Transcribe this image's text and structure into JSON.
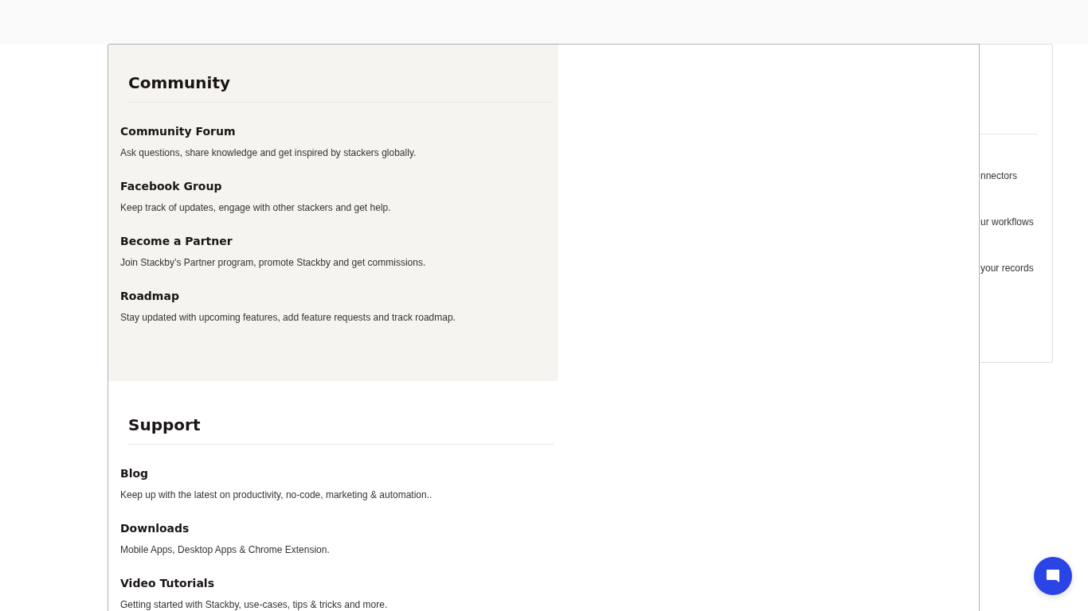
{
  "sections": [
    {
      "title": "Community",
      "kind": "tinted",
      "items": [
        {
          "title": "Community Forum",
          "description": "Ask questions, share knowledge and get inspired by stackers globally."
        },
        {
          "title": "Facebook Group",
          "description": "Keep track of updates, engage with other stackers and get help."
        },
        {
          "title": "Become a Partner",
          "description": "Join Stackby’s Partner program, promote Stackby and get commissions."
        },
        {
          "title": "Roadmap",
          "description": "Stay updated with upcoming features, add feature requests and track roadmap."
        }
      ]
    },
    {
      "title": "Support",
      "kind": "plain",
      "items": [
        {
          "title": "Blog",
          "description": "Keep up with the latest on productivity, no-code, marketing & automation.."
        },
        {
          "title": "Downloads",
          "description": "Mobile Apps, Desktop Apps & Chrome Extension."
        },
        {
          "title": "Video Tutorials",
          "description": "Getting started with Stackby, use-cases, tips & tricks and more."
        }
      ]
    }
  ],
  "back_card": {
    "lines": [
      "nnectors",
      "ur workflows",
      "your records"
    ]
  }
}
